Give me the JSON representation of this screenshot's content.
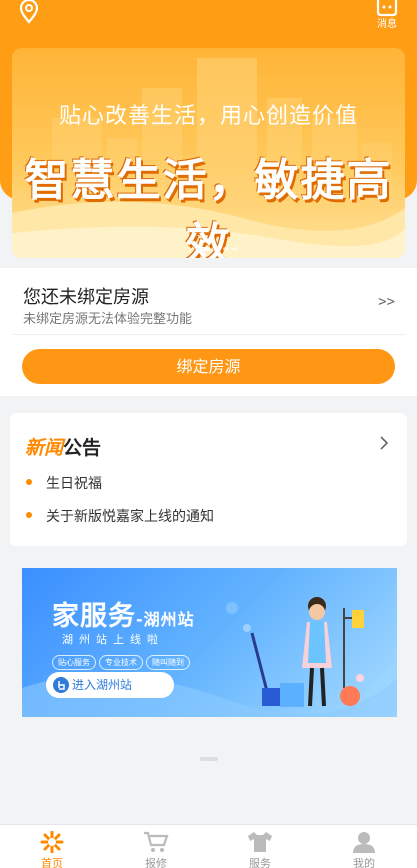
{
  "header": {
    "messages_label": "消息"
  },
  "banner": {
    "subtitle": "贴心改善生活，用心创造价值",
    "headline": "智慧生活，敏捷高效"
  },
  "binding": {
    "title": "您还未绑定房源",
    "description": "未绑定房源无法体验完整功能",
    "arrow": ">>",
    "button_label": "绑定房源"
  },
  "news": {
    "title_part1": "新闻",
    "title_part2": "公告",
    "items": [
      "生日祝福",
      "关于新版悦嘉家上线的通知"
    ]
  },
  "promo": {
    "title": "家服务",
    "title_suffix": "-湖州站",
    "slogan": "湖州站上线啦",
    "tags": [
      "贴心服务",
      "专业技术",
      "随叫随到"
    ],
    "enter_label": "进入湖州站"
  },
  "tabbar": {
    "items": [
      {
        "label": "首页",
        "icon": "home-icon"
      },
      {
        "label": "报修",
        "icon": "cart-icon"
      },
      {
        "label": "服务",
        "icon": "shirt-icon"
      },
      {
        "label": "我的",
        "icon": "user-icon"
      }
    ]
  },
  "colors": {
    "accent": "#ff9d14",
    "accent_dark": "#ff8a00",
    "promo_blue": "#3b8fff"
  }
}
